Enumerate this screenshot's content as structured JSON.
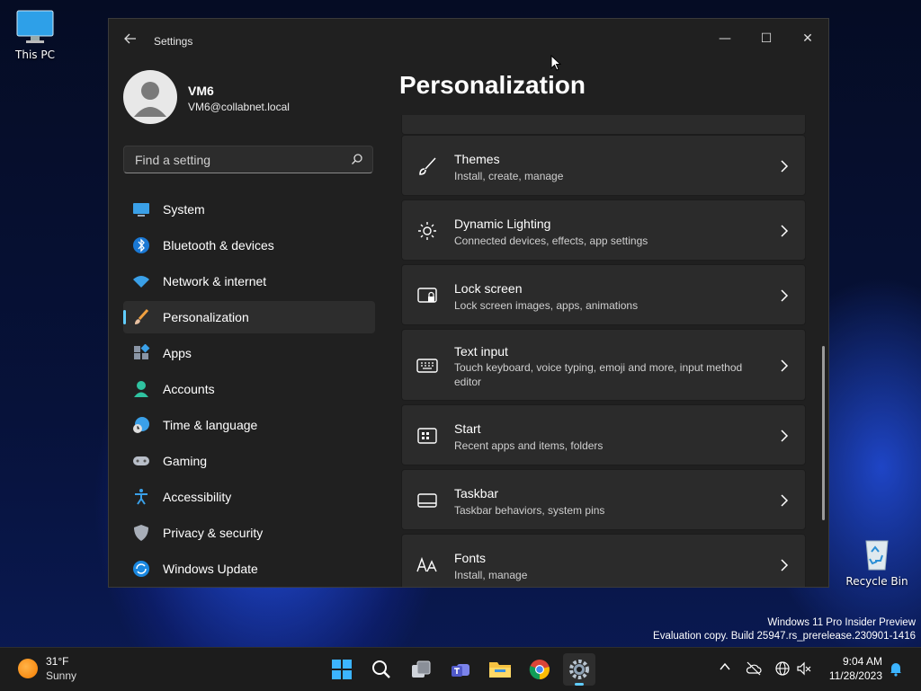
{
  "desktop": {
    "this_pc_label": "This PC",
    "recycle_bin_label": "Recycle Bin",
    "watermark_line1": "Windows 11 Pro Insider Preview",
    "watermark_line2": "Evaluation copy. Build 25947.rs_prerelease.230901-1416"
  },
  "window": {
    "title": "Settings",
    "controls": {
      "minimize": "—",
      "maximize": "☐",
      "close": "✕"
    }
  },
  "profile": {
    "name": "VM6",
    "email": "VM6@collabnet.local"
  },
  "search": {
    "placeholder": "Find a setting"
  },
  "nav": {
    "items": [
      {
        "label": "System",
        "icon": "system-icon"
      },
      {
        "label": "Bluetooth & devices",
        "icon": "bluetooth-icon"
      },
      {
        "label": "Network & internet",
        "icon": "wifi-icon"
      },
      {
        "label": "Personalization",
        "icon": "brush-icon",
        "selected": true
      },
      {
        "label": "Apps",
        "icon": "apps-icon"
      },
      {
        "label": "Accounts",
        "icon": "accounts-icon"
      },
      {
        "label": "Time & language",
        "icon": "globe-clock-icon"
      },
      {
        "label": "Gaming",
        "icon": "gamepad-icon"
      },
      {
        "label": "Accessibility",
        "icon": "accessibility-icon"
      },
      {
        "label": "Privacy & security",
        "icon": "shield-icon"
      },
      {
        "label": "Windows Update",
        "icon": "update-icon"
      }
    ]
  },
  "main": {
    "title": "Personalization",
    "cards": [
      {
        "title": "Themes",
        "subtitle": "Install, create, manage",
        "icon": "paintbrush-icon"
      },
      {
        "title": "Dynamic Lighting",
        "subtitle": "Connected devices, effects, app settings",
        "icon": "lighting-icon"
      },
      {
        "title": "Lock screen",
        "subtitle": "Lock screen images, apps, animations",
        "icon": "lock-screen-icon"
      },
      {
        "title": "Text input",
        "subtitle": "Touch keyboard, voice typing, emoji and more, input method editor",
        "icon": "keyboard-icon"
      },
      {
        "title": "Start",
        "subtitle": "Recent apps and items, folders",
        "icon": "start-icon"
      },
      {
        "title": "Taskbar",
        "subtitle": "Taskbar behaviors, system pins",
        "icon": "taskbar-icon"
      },
      {
        "title": "Fonts",
        "subtitle": "Install, manage",
        "icon": "fonts-icon"
      }
    ]
  },
  "taskbar": {
    "weather_temp": "31°F",
    "weather_condition": "Sunny",
    "time": "9:04 AM",
    "date": "11/28/2023"
  },
  "colors": {
    "accent": "#60cdff",
    "window_bg": "#202020",
    "card_bg": "#2b2b2b"
  }
}
